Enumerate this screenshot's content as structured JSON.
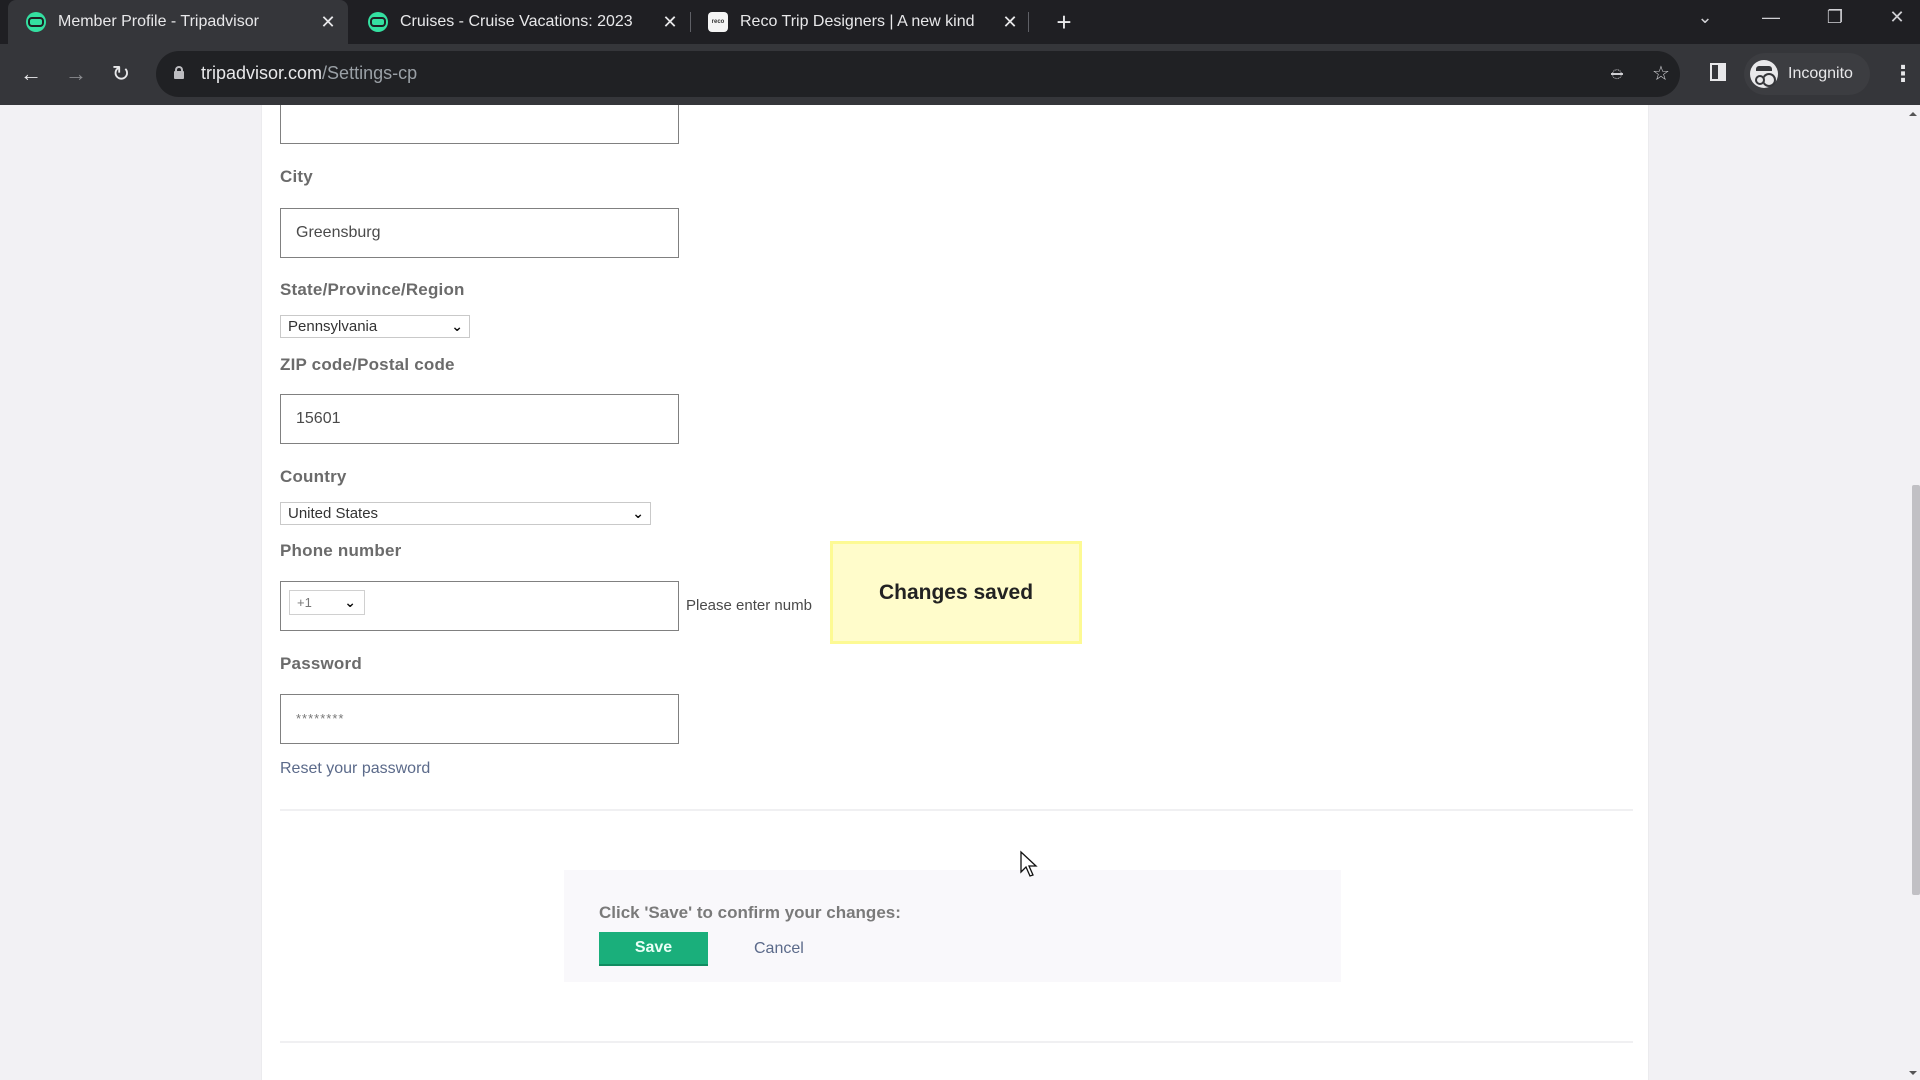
{
  "browser": {
    "tabs": [
      {
        "title": "Member Profile - Tripadvisor",
        "favicon": "tripadvisor-icon",
        "active": true
      },
      {
        "title": "Cruises - Cruise Vacations: 2023",
        "favicon": "tripadvisor-icon",
        "active": false
      },
      {
        "title": "Reco Trip Designers | A new kind",
        "favicon": "reco-icon",
        "active": false
      }
    ],
    "tab_close_glyph": "✕",
    "new_tab_glyph": "+",
    "tab_search_glyph": "⌄",
    "minimize_glyph": "—",
    "restore_glyph": "❐",
    "close_glyph": "✕",
    "back_glyph": "←",
    "forward_glyph": "→",
    "reload_glyph": "↻",
    "url_domain": "tripadvisor.com",
    "url_path": "/Settings-cp",
    "eye_off_glyph": "◌",
    "star_glyph": "☆",
    "incognito_label": "Incognito",
    "menu_glyph": "⋮",
    "reco_favicon_text": "reco"
  },
  "form": {
    "city": {
      "label": "City",
      "value": "Greensburg"
    },
    "state": {
      "label": "State/Province/Region",
      "value": "Pennsylvania"
    },
    "zip": {
      "label": "ZIP code/Postal code",
      "value": "15601"
    },
    "country": {
      "label": "Country",
      "value": "United States"
    },
    "phone": {
      "label": "Phone number",
      "country_code": "+1",
      "value": "",
      "hint": "Please enter numb"
    },
    "password": {
      "label": "Password",
      "value": "********"
    },
    "reset_link": "Reset your password",
    "chevron_glyph": "⌄"
  },
  "save_panel": {
    "prompt": "Click 'Save' to confirm your changes:",
    "save_label": "Save",
    "cancel_label": "Cancel"
  },
  "toast": {
    "message": "Changes saved"
  },
  "colors": {
    "save_green": "#1aaf7b",
    "toast_yellow": "#fffccb",
    "link_blue_gray": "#5b6a8a",
    "tripadvisor_green": "#34e0a1"
  }
}
